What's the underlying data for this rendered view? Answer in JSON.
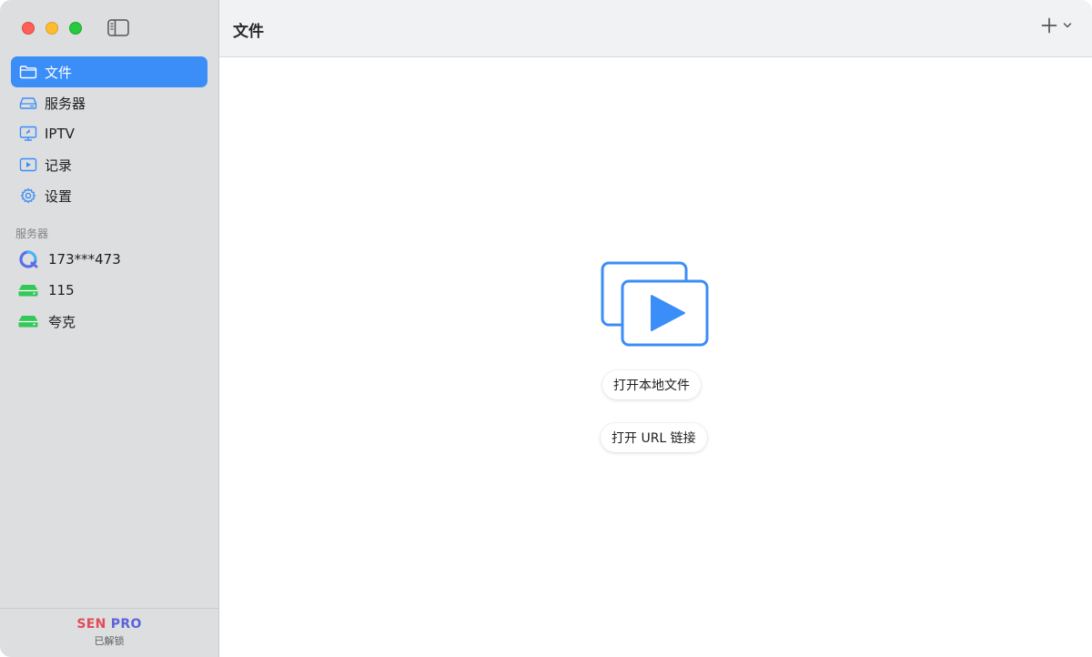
{
  "sidebar": {
    "nav": [
      {
        "label": "文件",
        "icon": "folder-icon",
        "active": true
      },
      {
        "label": "服务器",
        "icon": "server-icon",
        "active": false
      },
      {
        "label": "IPTV",
        "icon": "tv-icon",
        "active": false
      },
      {
        "label": "记录",
        "icon": "play-square-icon",
        "active": false
      },
      {
        "label": "设置",
        "icon": "gear-icon",
        "active": false
      }
    ],
    "section_label": "服务器",
    "servers": [
      {
        "label": "173***473",
        "icon": "cloud-drive-icon"
      },
      {
        "label": "115",
        "icon": "green-drive-icon"
      },
      {
        "label": "夸克",
        "icon": "green-drive-icon"
      }
    ],
    "footer": {
      "brand_sen": "SEN",
      "brand_pro": "PRO",
      "status": "已解锁"
    }
  },
  "header": {
    "title": "文件"
  },
  "main": {
    "open_local_label": "打开本地文件",
    "open_url_label": "打开 URL 链接"
  },
  "colors": {
    "accent": "#3b8df7",
    "sidebar_bg": "#dcdee0",
    "drive_green": "#34c759"
  }
}
